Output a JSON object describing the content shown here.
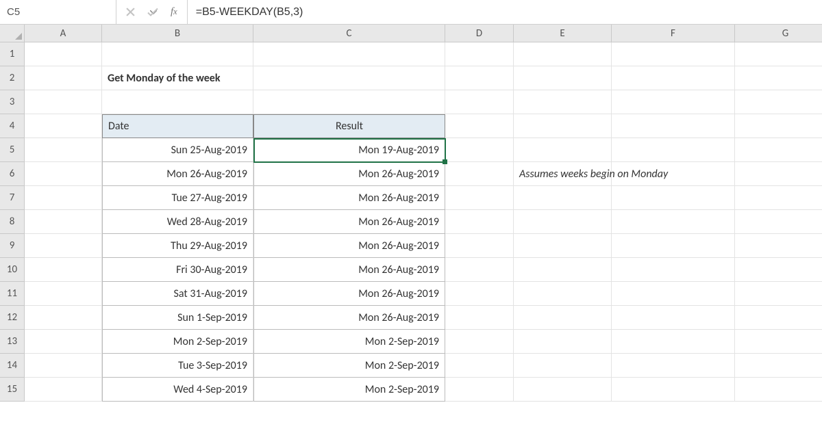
{
  "namebox": "C5",
  "formula": "=B5-WEEKDAY(B5,3)",
  "columns": [
    "A",
    "B",
    "C",
    "D",
    "E",
    "F",
    "G"
  ],
  "rownums": [
    "1",
    "2",
    "3",
    "4",
    "5",
    "6",
    "7",
    "8",
    "9",
    "10",
    "11",
    "12",
    "13",
    "14",
    "15"
  ],
  "title": "Get Monday of the week",
  "headers": {
    "date": "Date",
    "result": "Result"
  },
  "table": [
    {
      "date": "Sun 25-Aug-2019",
      "result": "Mon 19-Aug-2019"
    },
    {
      "date": "Mon 26-Aug-2019",
      "result": "Mon 26-Aug-2019"
    },
    {
      "date": "Tue 27-Aug-2019",
      "result": "Mon 26-Aug-2019"
    },
    {
      "date": "Wed 28-Aug-2019",
      "result": "Mon 26-Aug-2019"
    },
    {
      "date": "Thu 29-Aug-2019",
      "result": "Mon 26-Aug-2019"
    },
    {
      "date": "Fri 30-Aug-2019",
      "result": "Mon 26-Aug-2019"
    },
    {
      "date": "Sat 31-Aug-2019",
      "result": "Mon 26-Aug-2019"
    },
    {
      "date": "Sun 1-Sep-2019",
      "result": "Mon 26-Aug-2019"
    },
    {
      "date": "Mon 2-Sep-2019",
      "result": "Mon 2-Sep-2019"
    },
    {
      "date": "Tue 3-Sep-2019",
      "result": "Mon 2-Sep-2019"
    },
    {
      "date": "Wed 4-Sep-2019",
      "result": "Mon 2-Sep-2019"
    }
  ],
  "note": "Assumes weeks begin on Monday",
  "selection": {
    "cell": "C5"
  }
}
